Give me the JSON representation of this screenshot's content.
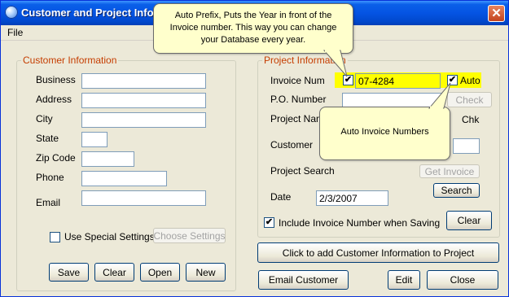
{
  "window": {
    "title": "Customer and Project Info",
    "close_symbol": "✕"
  },
  "menu": {
    "file": "File"
  },
  "customer": {
    "legend": "Customer Information",
    "business_label": "Business",
    "address_label": "Address",
    "city_label": "City",
    "state_label": "State",
    "zip_label": "Zip Code",
    "phone_label": "Phone",
    "email_label": "Email",
    "special_settings_label": "Use Special Settings",
    "choose_settings": "Choose Settings",
    "save": "Save",
    "clear": "Clear",
    "open": "Open",
    "new": "New"
  },
  "project": {
    "legend": "Project Information",
    "invoice_num_label": "Invoice Num",
    "invoice_num_value": "07-4284",
    "auto_label": "Auto",
    "po_label": "P.O. Number",
    "check": "Check",
    "project_name_label": "Project Name",
    "chk_label": "Chk",
    "customer_label": "Customer",
    "project_search_label": "Project Search",
    "get_invoice": "Get Invoice",
    "search": "Search",
    "date_label": "Date",
    "date_value": "2/3/2007",
    "include_invoice_label": "Include Invoice Number when Saving",
    "clear": "Clear"
  },
  "actions": {
    "add_customer_info": "Click to add Customer Information to Project",
    "email_customer": "Email Customer",
    "edit": "Edit",
    "close": "Close"
  },
  "tooltips": {
    "prefix_line1": "Auto Prefix, Puts the Year in front of the",
    "prefix_line2": "Invoice number. This way you can change",
    "prefix_line3": "your Database every year.",
    "auto_numbers": "Auto Invoice Numbers"
  },
  "colors": {
    "highlight": "#ffff00",
    "legend": "#c53d00",
    "titlebar": "#0554e3"
  }
}
